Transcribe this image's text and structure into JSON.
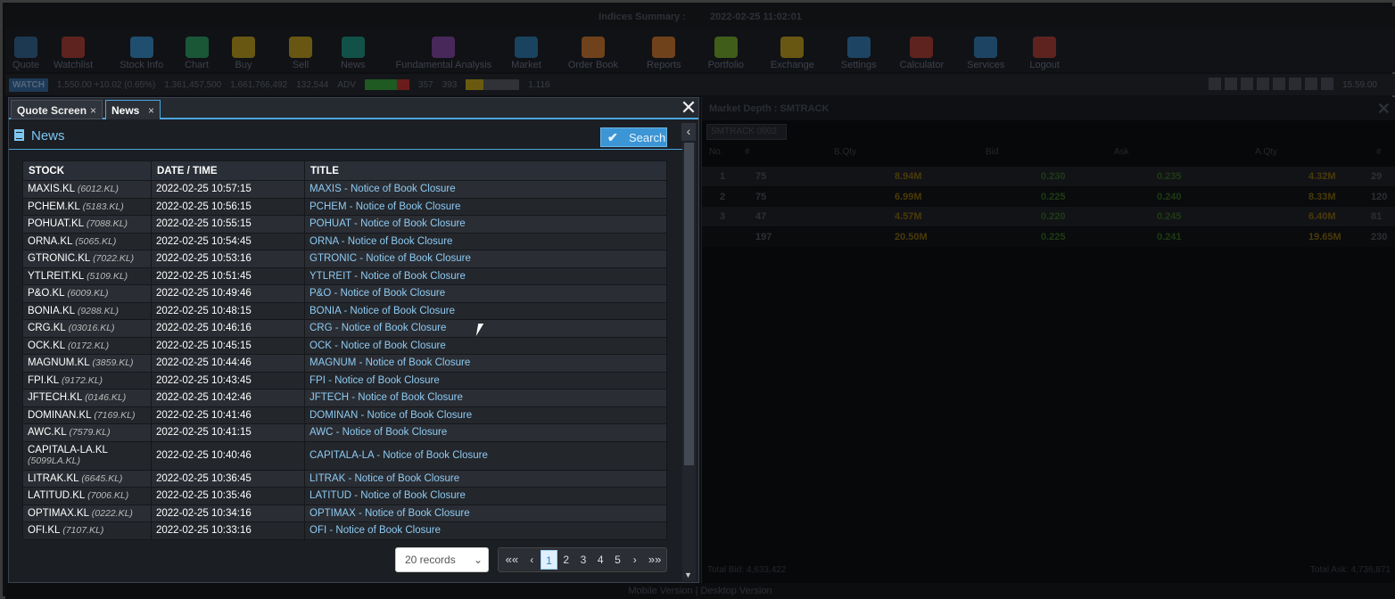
{
  "window": {
    "title": "Indices Summary :",
    "datetime": "2022-02-25 11:02:01"
  },
  "toolbar": [
    {
      "label": "Quote",
      "icon": "chart-bars-icon",
      "color": "#2f6a9c"
    },
    {
      "label": "Watchlist",
      "icon": "heart-icon",
      "color": "#c0392b"
    },
    {
      "label": "Stock Info",
      "icon": "info-icon",
      "color": "#3498db"
    },
    {
      "label": "Chart",
      "icon": "chart-icon",
      "color": "#27ae60"
    },
    {
      "label": "Buy",
      "icon": "buy-icon",
      "color": "#d4ac0d"
    },
    {
      "label": "Sell",
      "icon": "sell-icon",
      "color": "#d4ac0d"
    },
    {
      "label": "News",
      "icon": "news-icon",
      "color": "#16a085"
    },
    {
      "label": "Fundamental Analysis",
      "icon": "fundamental-icon",
      "color": "#8e44ad"
    },
    {
      "label": "Market",
      "icon": "market-icon",
      "color": "#2980b9"
    },
    {
      "label": "Order Book",
      "icon": "order-book-icon",
      "color": "#e67e22"
    },
    {
      "label": "Reports",
      "icon": "reports-icon",
      "color": "#e67e22"
    },
    {
      "label": "Portfolio",
      "icon": "portfolio-icon",
      "color": "#7dbb1e"
    },
    {
      "label": "Exchange",
      "icon": "exchange-icon",
      "color": "#d4ac0d"
    },
    {
      "label": "Settings",
      "icon": "gear-icon",
      "color": "#2e86c1"
    },
    {
      "label": "Calculator",
      "icon": "calculator-icon",
      "color": "#c0392b"
    },
    {
      "label": "Services",
      "icon": "services-icon",
      "color": "#2e86c1"
    },
    {
      "label": "Logout",
      "icon": "logout-icon",
      "color": "#c0392b"
    }
  ],
  "statusbar": {
    "watch": "WATCH",
    "index": "1,550.00 +10.02 (0.65%)",
    "volume": "1,361,457,500",
    "value": "1,661,766,492",
    "trades": "132,544",
    "adv_label": "ADV",
    "adv_value": "357",
    "unc_label": "393",
    "unc_value": "1,116",
    "right_label": "15.59.00"
  },
  "tabs": {
    "quote_screen": "Quote Screen",
    "news": "News",
    "close_glyph": "×"
  },
  "news": {
    "heading": "News",
    "search_label": "Search",
    "columns": {
      "stock": "STOCK",
      "datetime": "DATE / TIME",
      "title": "TITLE"
    },
    "rows": [
      {
        "stock": "MAXIS.KL",
        "code": "(6012.KL)",
        "datetime": "2022-02-25 10:57:15",
        "title": "MAXIS - Notice of Book Closure"
      },
      {
        "stock": "PCHEM.KL",
        "code": "(5183.KL)",
        "datetime": "2022-02-25 10:56:15",
        "title": "PCHEM - Notice of Book Closure"
      },
      {
        "stock": "POHUAT.KL",
        "code": "(7088.KL)",
        "datetime": "2022-02-25 10:55:15",
        "title": "POHUAT - Notice of Book Closure"
      },
      {
        "stock": "ORNA.KL",
        "code": "(5065.KL)",
        "datetime": "2022-02-25 10:54:45",
        "title": "ORNA - Notice of Book Closure"
      },
      {
        "stock": "GTRONIC.KL",
        "code": "(7022.KL)",
        "datetime": "2022-02-25 10:53:16",
        "title": "GTRONIC - Notice of Book Closure"
      },
      {
        "stock": "YTLREIT.KL",
        "code": "(5109.KL)",
        "datetime": "2022-02-25 10:51:45",
        "title": "YTLREIT - Notice of Book Closure"
      },
      {
        "stock": "P&O.KL",
        "code": "(6009.KL)",
        "datetime": "2022-02-25 10:49:46",
        "title": "P&O - Notice of Book Closure"
      },
      {
        "stock": "BONIA.KL",
        "code": "(9288.KL)",
        "datetime": "2022-02-25 10:48:15",
        "title": "BONIA - Notice of Book Closure"
      },
      {
        "stock": "CRG.KL",
        "code": "(03016.KL)",
        "datetime": "2022-02-25 10:46:16",
        "title": "CRG - Notice of Book Closure"
      },
      {
        "stock": "OCK.KL",
        "code": "(0172.KL)",
        "datetime": "2022-02-25 10:45:15",
        "title": "OCK - Notice of Book Closure"
      },
      {
        "stock": "MAGNUM.KL",
        "code": "(3859.KL)",
        "datetime": "2022-02-25 10:44:46",
        "title": "MAGNUM - Notice of Book Closure"
      },
      {
        "stock": "FPI.KL",
        "code": "(9172.KL)",
        "datetime": "2022-02-25 10:43:45",
        "title": "FPI - Notice of Book Closure"
      },
      {
        "stock": "JFTECH.KL",
        "code": "(0146.KL)",
        "datetime": "2022-02-25 10:42:46",
        "title": "JFTECH - Notice of Book Closure"
      },
      {
        "stock": "DOMINAN.KL",
        "code": "(7169.KL)",
        "datetime": "2022-02-25 10:41:46",
        "title": "DOMINAN - Notice of Book Closure"
      },
      {
        "stock": "AWC.KL",
        "code": "(7579.KL)",
        "datetime": "2022-02-25 10:41:15",
        "title": "AWC - Notice of Book Closure"
      },
      {
        "stock": "CAPITALA-LA.KL",
        "code": "(5099LA.KL)",
        "datetime": "2022-02-25 10:40:46",
        "title": "CAPITALA-LA - Notice of Book Closure"
      },
      {
        "stock": "LITRAK.KL",
        "code": "(6645.KL)",
        "datetime": "2022-02-25 10:36:45",
        "title": "LITRAK - Notice of Book Closure"
      },
      {
        "stock": "LATITUD.KL",
        "code": "(7006.KL)",
        "datetime": "2022-02-25 10:35:46",
        "title": "LATITUD - Notice of Book Closure"
      },
      {
        "stock": "OPTIMAX.KL",
        "code": "(0222.KL)",
        "datetime": "2022-02-25 10:34:16",
        "title": "OPTIMAX - Notice of Book Closure"
      },
      {
        "stock": "OFI.KL",
        "code": "(7107.KL)",
        "datetime": "2022-02-25 10:33:16",
        "title": "OFI - Notice of Book Closure"
      }
    ],
    "records_select": "20 records",
    "pager": {
      "first": "««",
      "prev": "‹",
      "pages": [
        "1",
        "2",
        "3",
        "4",
        "5"
      ],
      "active": "1",
      "next": "›",
      "last": "»»"
    }
  },
  "market_depth": {
    "title": "Market Depth : SMTRACK",
    "input_placeholder": "SMTRACK 0002",
    "columns": [
      "No.",
      "#",
      "B.Qty",
      "Bid",
      "Ask",
      "A.Qty",
      "#"
    ],
    "rows": [
      [
        "1",
        "75",
        "8.94M",
        "0.230",
        "0.235",
        "4.32M",
        "29"
      ],
      [
        "2",
        "75",
        "6.99M",
        "0.225",
        "0.240",
        "8.33M",
        "120"
      ],
      [
        "3",
        "47",
        "4.57M",
        "0.220",
        "0.245",
        "6.40M",
        "81"
      ],
      [
        "",
        "197",
        "20.50M",
        "0.225",
        "0.241",
        "19.65M",
        "230"
      ]
    ],
    "total_bid": "Total Bid: 4,633,422",
    "total_ask": "Total Ask: 4,736,871"
  },
  "footer": {
    "left": "Mobile Version",
    "right": "Desktop Version"
  }
}
